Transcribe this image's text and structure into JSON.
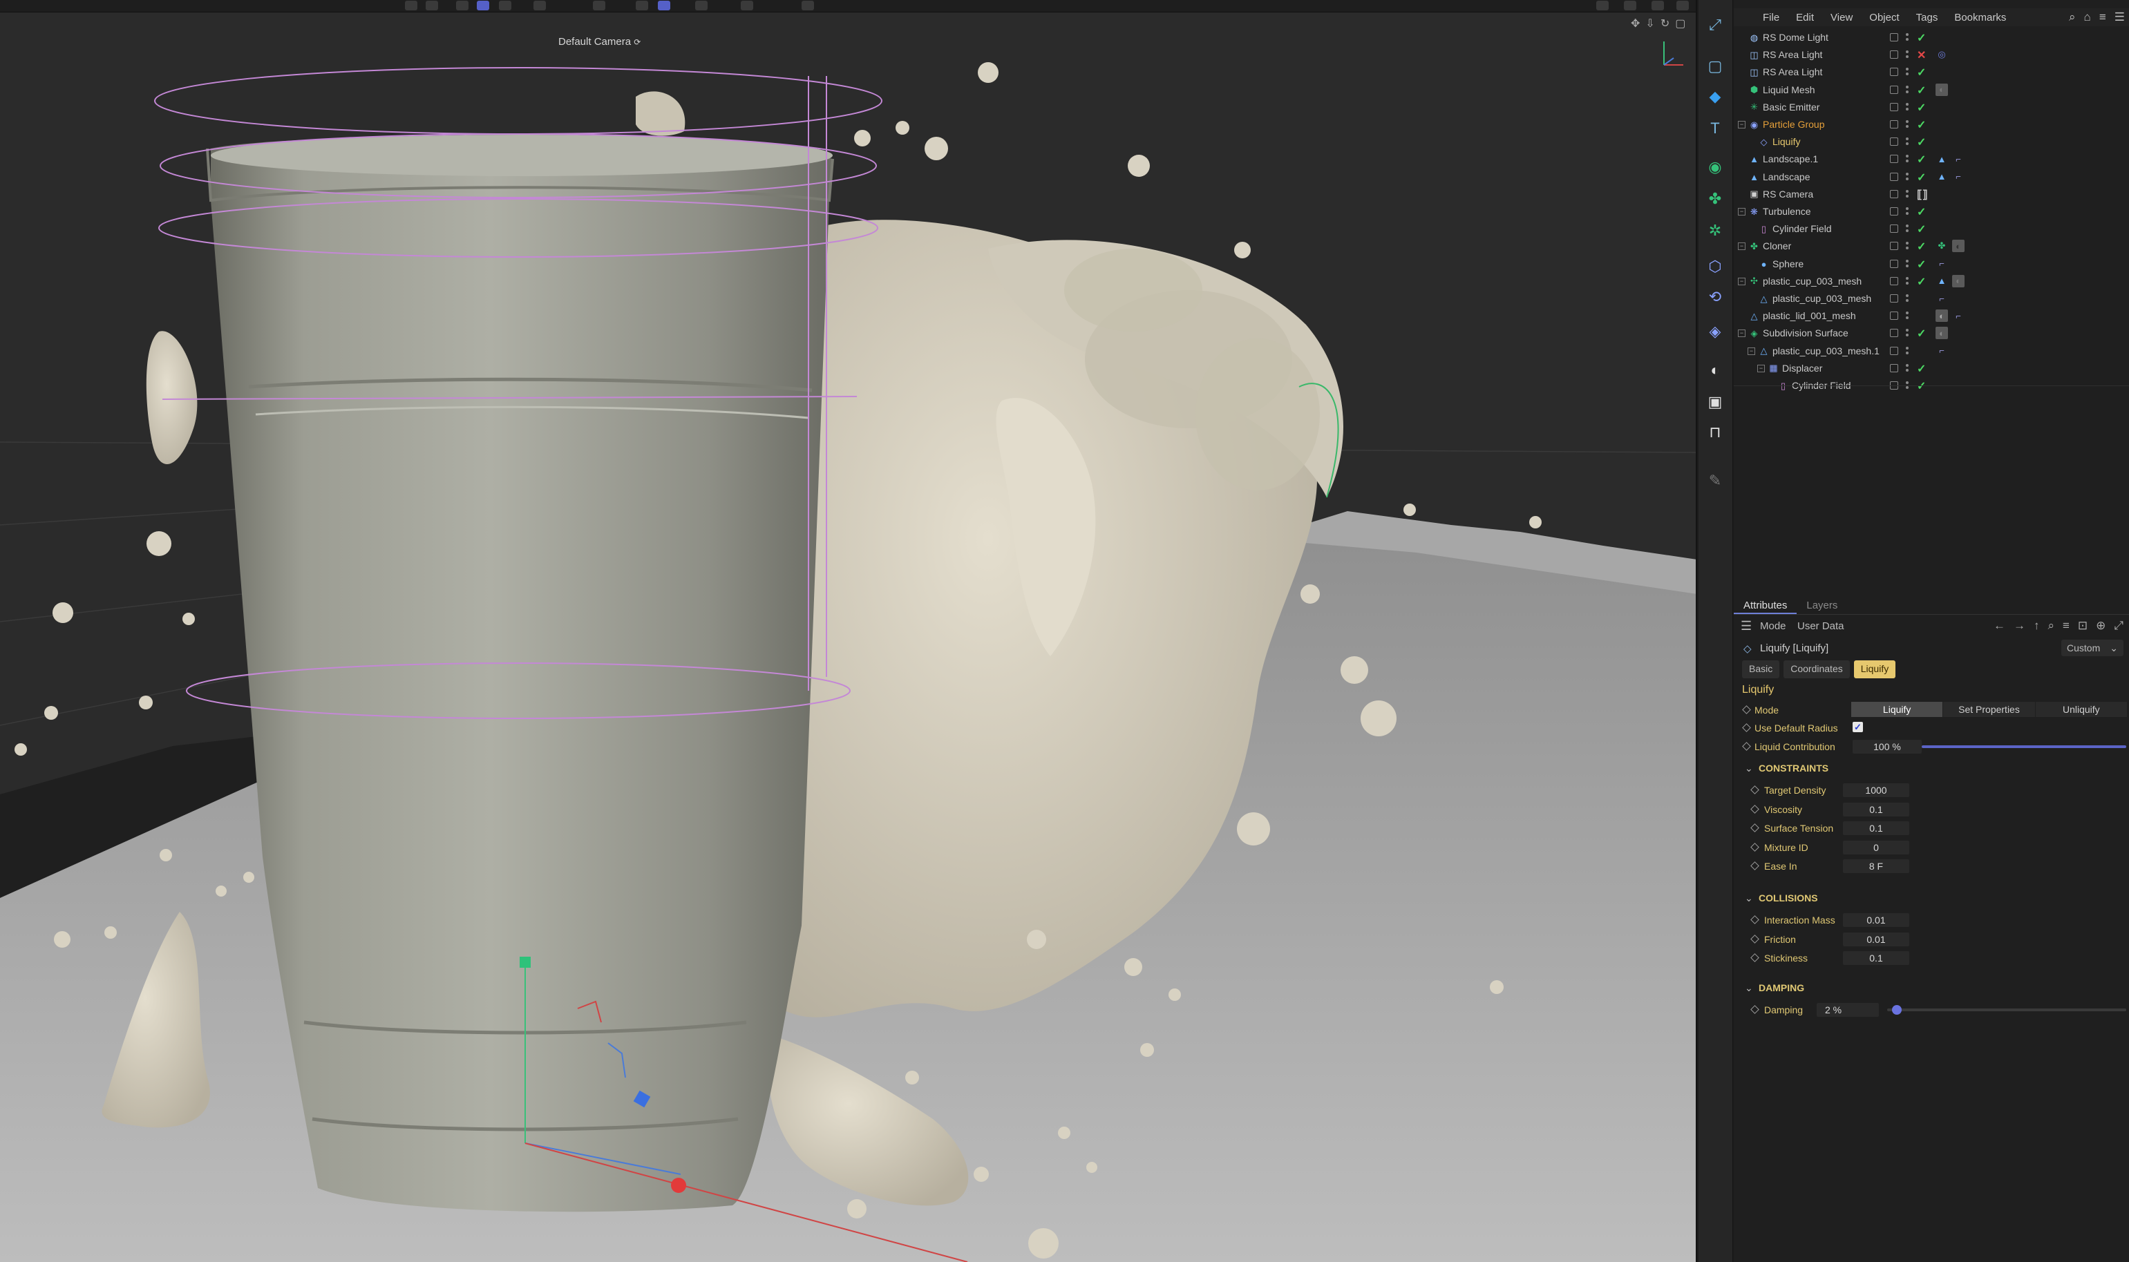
{
  "viewport": {
    "camera_label": "Default Camera",
    "camera_icon": "camera-link-icon"
  },
  "object_manager": {
    "menu": [
      "File",
      "Edit",
      "View",
      "Object",
      "Tags",
      "Bookmarks"
    ],
    "objects": [
      {
        "name": "RS Dome Light",
        "icon": "dome-light-icon",
        "state": "check"
      },
      {
        "name": "RS Area Light",
        "icon": "area-light-icon",
        "state": "cross"
      },
      {
        "name": "RS Area Light",
        "icon": "area-light-icon",
        "state": "check"
      },
      {
        "name": "Liquid Mesh",
        "icon": "liquid-mesh-icon",
        "state": "check"
      },
      {
        "name": "Basic Emitter",
        "icon": "emitter-icon",
        "state": "check"
      },
      {
        "name": "Particle Group",
        "icon": "particle-group-icon",
        "state": "check"
      },
      {
        "name": "Liquify",
        "icon": "liquify-icon",
        "state": "check"
      },
      {
        "name": "Landscape.1",
        "icon": "landscape-icon",
        "state": "check"
      },
      {
        "name": "Landscape",
        "icon": "landscape-icon",
        "state": "check"
      },
      {
        "name": "RS Camera",
        "icon": "camera-icon",
        "state": "tag"
      },
      {
        "name": "Turbulence",
        "icon": "turbulence-icon",
        "state": "check"
      },
      {
        "name": "Cylinder Field",
        "icon": "cylinder-field-icon",
        "state": "check"
      },
      {
        "name": "Cloner",
        "icon": "cloner-icon",
        "state": "check"
      },
      {
        "name": "Sphere",
        "icon": "sphere-icon",
        "state": "check"
      },
      {
        "name": "plastic_cup_003_mesh",
        "icon": "null-icon",
        "state": "check"
      },
      {
        "name": "plastic_cup_003_mesh",
        "icon": "polygon-icon",
        "state": "none"
      },
      {
        "name": "plastic_lid_001_mesh",
        "icon": "polygon-icon",
        "state": "none"
      },
      {
        "name": "Subdivision Surface",
        "icon": "subdivision-icon",
        "state": "check"
      },
      {
        "name": "plastic_cup_003_mesh.1",
        "icon": "polygon-icon",
        "state": "none"
      },
      {
        "name": "Displacer",
        "icon": "displacer-icon",
        "state": "check"
      },
      {
        "name": "Cylinder Field",
        "icon": "cylinder-field-icon",
        "state": "check"
      }
    ]
  },
  "attributes": {
    "tabs": [
      "Attributes",
      "Layers"
    ],
    "mode_label": "Mode",
    "user_data_label": "User Data",
    "object_title": "Liquify [Liquify]",
    "preset": "Custom",
    "subtabs": [
      "Basic",
      "Coordinates",
      "Liquify"
    ],
    "section": "Liquify",
    "mode": {
      "label": "Mode",
      "options": [
        "Liquify",
        "Set Properties",
        "Unliquify"
      ],
      "selected": "Liquify"
    },
    "use_default_radius": {
      "label": "Use Default Radius",
      "checked": true
    },
    "liquid_contribution": {
      "label": "Liquid Contribution",
      "value": "100 %",
      "fraction": 1.0
    },
    "constraints": {
      "title": "CONSTRAINTS",
      "fields": [
        {
          "label": "Target Density",
          "value": "1000"
        },
        {
          "label": "Viscosity",
          "value": "0.1"
        },
        {
          "label": "Surface Tension",
          "value": "0.1"
        },
        {
          "label": "Mixture ID",
          "value": "0"
        },
        {
          "label": "Ease In",
          "value": "8 F"
        }
      ]
    },
    "collisions": {
      "title": "COLLISIONS",
      "fields": [
        {
          "label": "Interaction Mass",
          "value": "0.01"
        },
        {
          "label": "Friction",
          "value": "0.01"
        },
        {
          "label": "Stickiness",
          "value": "0.1"
        }
      ]
    },
    "damping": {
      "title": "DAMPING",
      "label": "Damping",
      "value": "2 %",
      "fraction": 0.02
    }
  },
  "colors": {
    "accent": "#5b64c6",
    "section_yellow": "#e6c86e",
    "liquid": "#d7d0bf",
    "cup": "#9a9b90",
    "check_green": "#4cd964",
    "cross_red": "#e54848"
  }
}
